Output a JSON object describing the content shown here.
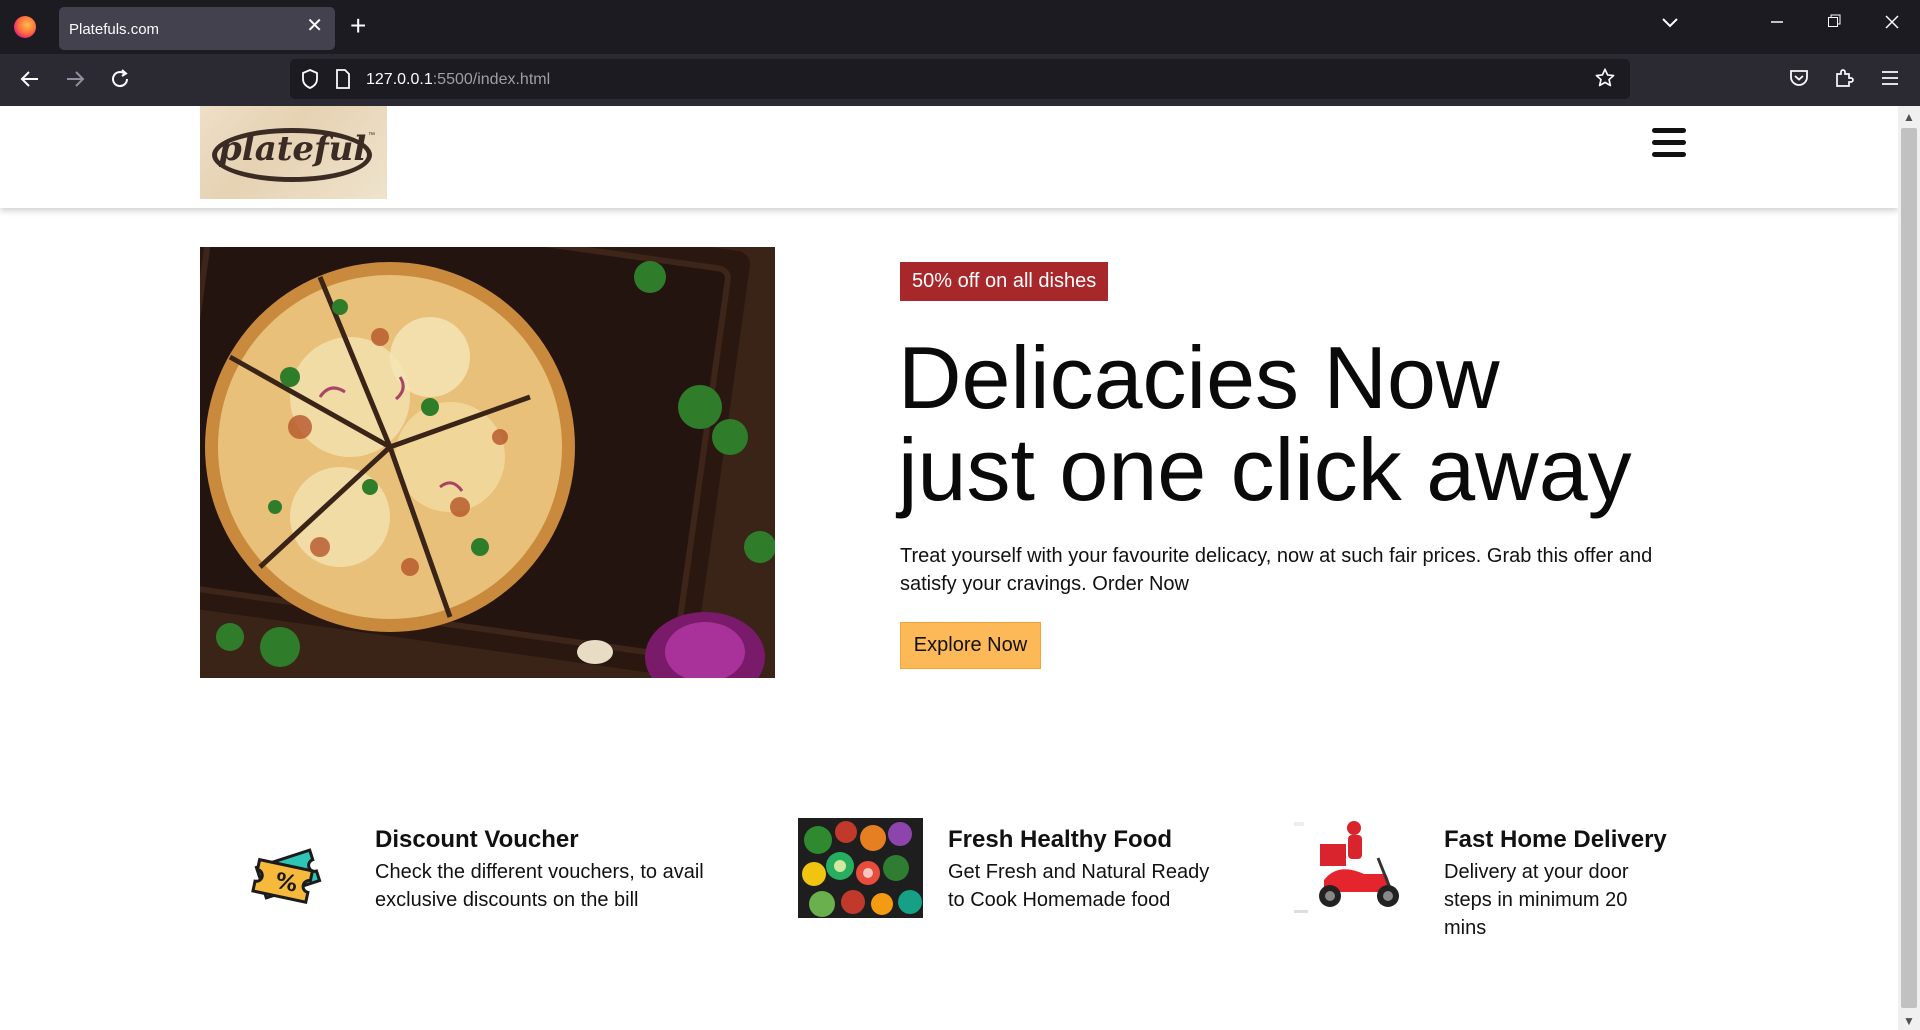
{
  "browser": {
    "tab_title": "Platefuls.com",
    "url_host": "127.0.0.1",
    "url_path": ":5500/index.html"
  },
  "hero": {
    "badge": "50% off on all dishes",
    "headline_line1": "Delicacies Now",
    "headline_line2": "just one click away",
    "description": "Treat yourself with your favourite delicacy, now at such fair prices. Grab this offer and satisfy your cravings. Order Now",
    "cta_label": "Explore Now"
  },
  "features": [
    {
      "title": "Discount Voucher",
      "description": "Check the different vouchers, to avail exclusive discounts on the bill",
      "icon": "voucher-icon"
    },
    {
      "title": "Fresh Healthy Food",
      "description": "Get Fresh and Natural Ready to Cook Homemade food",
      "icon": "vegetables-image"
    },
    {
      "title": "Fast Home Delivery",
      "description": "Delivery at your door steps in minimum 20 mins",
      "icon": "delivery-scooter-image"
    }
  ],
  "colors": {
    "badge_bg": "#a7272b",
    "cta_bg": "#fdb957",
    "browser_tabbar": "#1c1b22",
    "browser_navbar": "#2b2a33"
  }
}
